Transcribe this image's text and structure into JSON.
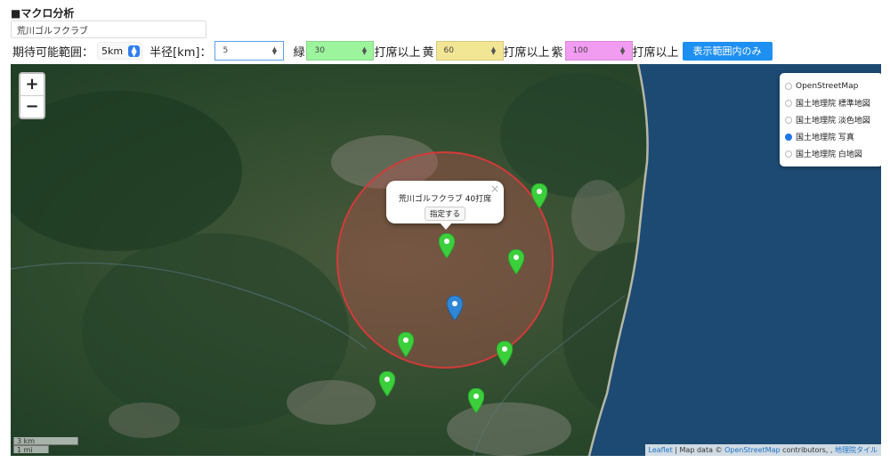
{
  "title": "■マクロ分析",
  "course_name": "荒川ゴルフクラブ",
  "controls": {
    "range_label": "期待可能範囲：",
    "range_value": "5km",
    "radius_label": "半径[km]：",
    "radius_value": "5",
    "green_label": "緑",
    "green_value": "30",
    "yellow_label": "黄",
    "yellow_value": "60",
    "purple_label": "紫",
    "purple_value": "100",
    "suffix": "打席以上",
    "filter_button": "表示範囲内のみ"
  },
  "map": {
    "zoom_in": "+",
    "zoom_out": "−",
    "layers": [
      {
        "label": "OpenStreetMap",
        "selected": false
      },
      {
        "label": "国土地理院 標準地図",
        "selected": false
      },
      {
        "label": "国土地理院 淡色地図",
        "selected": false
      },
      {
        "label": "国土地理院 写真",
        "selected": true
      },
      {
        "label": "国土地理院 白地図",
        "selected": false
      }
    ],
    "popup": {
      "text": "荒川ゴルフクラブ 40打席",
      "button": "指定する",
      "close": "×"
    },
    "scale": {
      "km": "3 km",
      "mi": "1 mi"
    },
    "attribution": {
      "leaflet": "Leaflet",
      "sep1": " | Map data © ",
      "osm": "OpenStreetMap",
      "sep2": " contributors, , ",
      "gsi": "地理院タイル"
    },
    "colors": {
      "green_marker": "#3ccf3c",
      "blue_marker": "#2f86d6",
      "circle_stroke": "#d43a3a",
      "sea": "#1d4a72",
      "land": "#2c4a2c"
    }
  }
}
